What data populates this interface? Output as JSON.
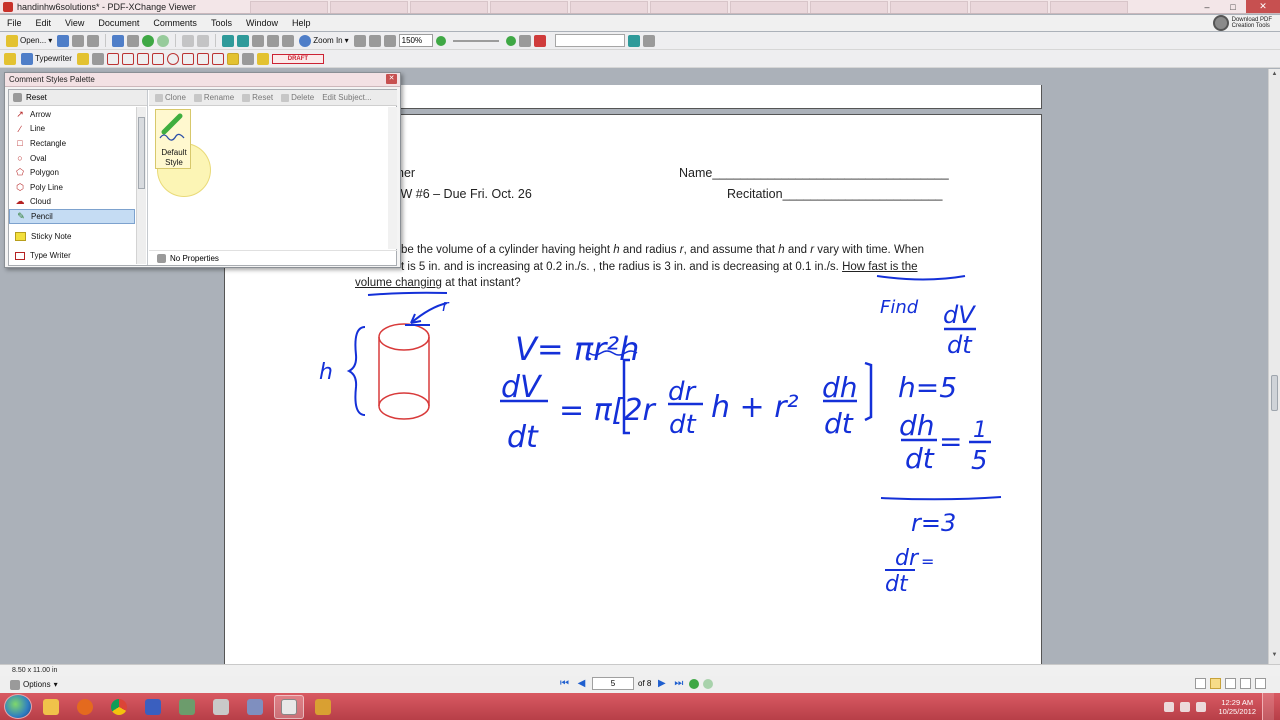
{
  "window": {
    "title": "handinhw6solutions* - PDF-XChange Viewer"
  },
  "menu": [
    "File",
    "Edit",
    "View",
    "Document",
    "Comments",
    "Tools",
    "Window",
    "Help"
  ],
  "promo": {
    "line1": "Download PDF",
    "line2": "Creation Tools"
  },
  "toolbar": {
    "open_label": "Open...",
    "zoom_in_label": "Zoom In",
    "zoom_value": "150%",
    "typewriter_label": "Typewriter",
    "draft_label": "DRAFT"
  },
  "palette": {
    "title": "Comment Styles Palette",
    "reset_label": "Reset",
    "tools": [
      {
        "label": "Arrow",
        "icon": "arrow-icon"
      },
      {
        "label": "Line",
        "icon": "line-icon"
      },
      {
        "label": "Rectangle",
        "icon": "rectangle-icon"
      },
      {
        "label": "Oval",
        "icon": "oval-icon"
      },
      {
        "label": "Polygon",
        "icon": "polygon-icon"
      },
      {
        "label": "Poly Line",
        "icon": "polyline-icon"
      },
      {
        "label": "Cloud",
        "icon": "cloud-icon"
      },
      {
        "label": "Pencil",
        "icon": "pencil-icon",
        "selected": true
      },
      {
        "label": "Sticky Note",
        "icon": "sticky-note-icon"
      },
      {
        "label": "Type Writer",
        "icon": "typewriter-icon"
      }
    ],
    "actions": [
      "Clone",
      "Rename",
      "Reset",
      "Delete",
      "Edit Subject..."
    ],
    "style_name_line1": "Default",
    "style_name_line2": "Style",
    "no_properties": "No Properties"
  },
  "document": {
    "header_left_1": "her",
    "header_left_2": "IW #6 – Due Fri. Oct. 26",
    "name_label": "Name__________________________________",
    "recitation_label": "Recitation_______________________",
    "problem_line1_a": " be the volume of a cylinder having height ",
    "problem_line1_h": "h",
    "problem_line1_b": " and radius ",
    "problem_line1_r": "r",
    "problem_line1_c": ", and assume that ",
    "problem_line1_h2": "h",
    "problem_line1_d": " and ",
    "problem_line1_r2": "r",
    "problem_line1_e": " vary with time.  When",
    "problem_line2_a": "t is 5 in. and is increasing at 0.2 in./s. , the radius is 3 in. and is decreasing at 0.1 in./s.  ",
    "problem_line2_u": "How fast is the",
    "problem_line3_u": "volume changing",
    "problem_line3_b": " at that instant?"
  },
  "handwriting": {
    "h_label": "h",
    "r_label": "r",
    "volume_formula": "V= πr²h",
    "find": "Find",
    "dV": "dV",
    "dt": "dt",
    "h5": "h=5",
    "dh": "dh",
    "eq_one_fifth_num": "1",
    "eq_one_fifth_den": "5",
    "r3": "r=3",
    "dr": "dr",
    "derivative_lhs_dV": "dV",
    "derivative_lhs_dt": "dt",
    "derivative_rhs": "= π[2r",
    "derivative_h": "h + r²",
    "colors": {
      "ink": "#1430d8",
      "cylinder": "#d83a3a"
    }
  },
  "status": {
    "page_size": "8.50 x 11.00 in",
    "options_label": "Options",
    "current_page": "5",
    "page_count": "of 8"
  },
  "taskbar": {
    "time": "12:29 AM",
    "date": "10/25/2012",
    "apps": [
      "explorer-icon",
      "firefox-icon",
      "chrome-icon",
      "xchange-icon",
      "game-icon",
      "calculator-icon",
      "paint-icon",
      "pdf-viewer-icon",
      "folder-icon"
    ]
  }
}
